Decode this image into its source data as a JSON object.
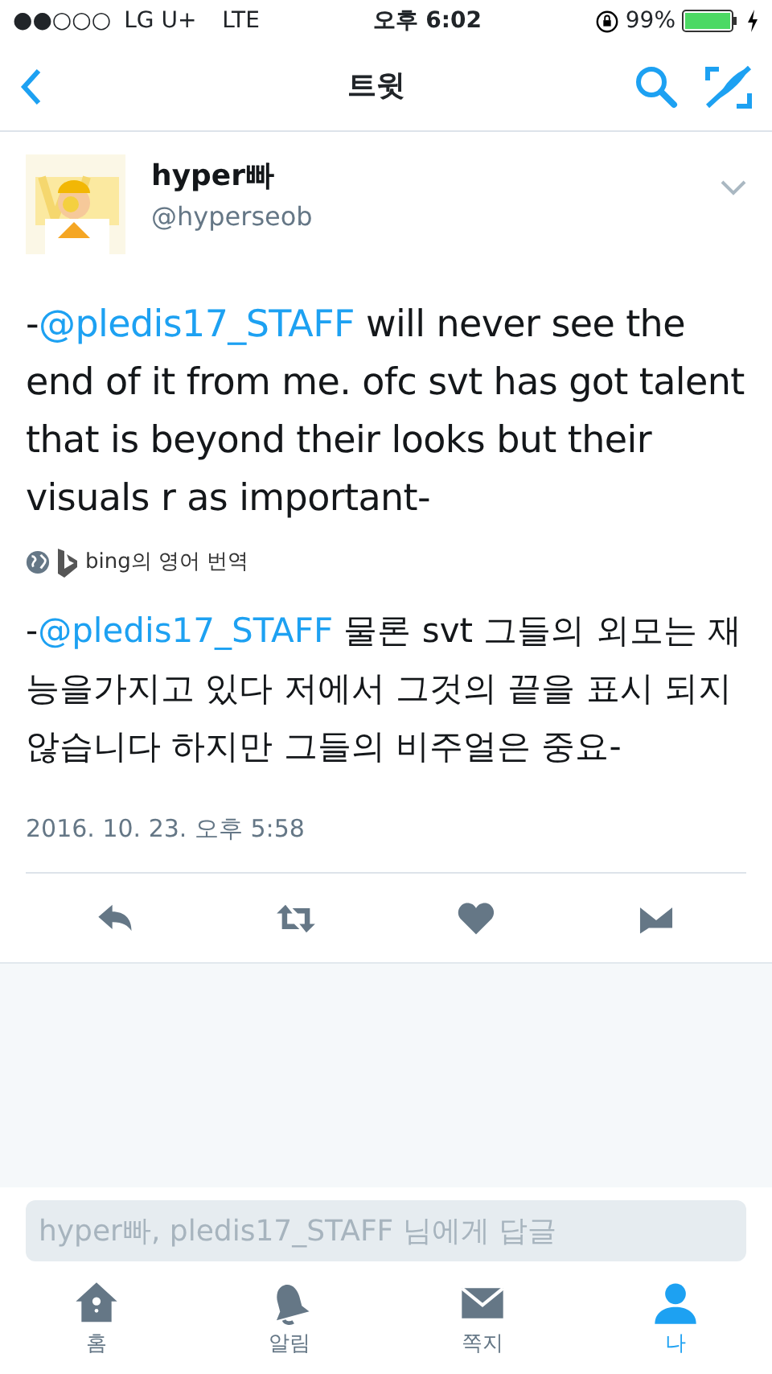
{
  "status_bar": {
    "signal": "●●○○○",
    "carrier": "LG U+",
    "network": "LTE",
    "time": "오후 6:02",
    "battery_percent": "99%"
  },
  "nav": {
    "title": "트윗"
  },
  "tweet": {
    "name": "hyper빠",
    "handle": "@hyperseob",
    "text": [
      {
        "kind": "plain",
        "text": "-"
      },
      {
        "kind": "mention",
        "text": "@pledis17_STAFF"
      },
      {
        "kind": "plain",
        "text": " will never see the end of it from me. ofc svt has got talent that is beyond their looks but their visuals r as important-"
      }
    ],
    "translation_label": "bing의 영어 번역",
    "translation": [
      {
        "kind": "plain",
        "text": "-"
      },
      {
        "kind": "mention",
        "text": "@pledis17_STAFF"
      },
      {
        "kind": "plain",
        "text": " 물론 svt 그들의 외모는 재능을가지고 있다 저에서 그것의 끝을 표시 되지 않습니다 하지만 그들의 비주얼은 중요-"
      }
    ],
    "timestamp": "2016. 10. 23. 오후 5:58"
  },
  "reply": {
    "placeholder": "hyper빠, pledis17_STAFF 님에게 답글"
  },
  "tabs": [
    {
      "kind": "home",
      "label": "홈",
      "selected": false
    },
    {
      "kind": "bell",
      "label": "알림",
      "selected": false
    },
    {
      "kind": "mail",
      "label": "쪽지",
      "selected": false
    },
    {
      "kind": "person",
      "label": "나",
      "selected": true
    }
  ]
}
